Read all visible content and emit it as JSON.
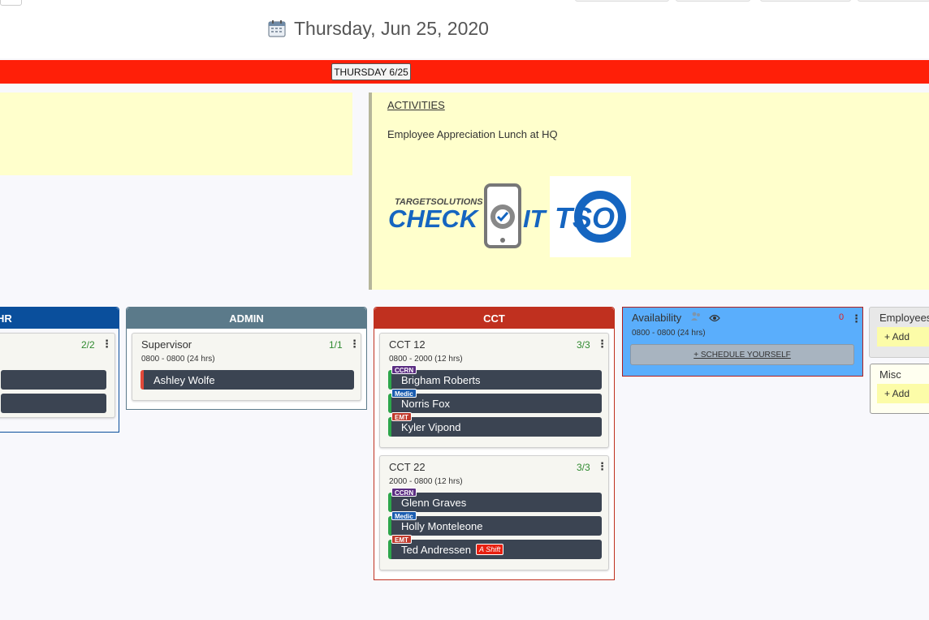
{
  "header": {
    "date": "Thursday, Jun 25, 2020"
  },
  "day_bar": {
    "day_button_label": "THURSDAY 6/25",
    "bar_color": "#ff1f08"
  },
  "notes": {
    "activities_title": "ACTIVITIES",
    "activities_item": "Employee Appreciation Lunch at HQ",
    "logos": {
      "checkit_top": "TARGETSOLUTIONS",
      "checkit_word_left": "CHECK",
      "checkit_word_right": "IT",
      "tso": "TSO"
    }
  },
  "columns": {
    "hr": {
      "title": "HR",
      "color": "#0a4f9c",
      "card": {
        "count": "2/2"
      }
    },
    "admin": {
      "title": "ADMIN",
      "color": "#5b7a8a",
      "card": {
        "title": "Supervisor",
        "count": "1/1",
        "time": "0800 - 0800 (24 hrs)",
        "people": [
          {
            "name": "Ashley Wolfe"
          }
        ]
      }
    },
    "cct": {
      "title": "CCT",
      "color": "#c0301f",
      "cards": [
        {
          "title": "CCT 12",
          "count": "3/3",
          "time": "0800 - 2000 (12 hrs)",
          "people": [
            {
              "badge": "CCRN",
              "name": "Brigham Roberts"
            },
            {
              "badge": "Medic",
              "name": "Norris Fox"
            },
            {
              "badge": "EMT",
              "name": "Kyler Vipond"
            }
          ]
        },
        {
          "title": "CCT 22",
          "count": "3/3",
          "time": "2000 - 0800 (12 hrs)",
          "people": [
            {
              "badge": "CCRN",
              "name": "Glenn Graves"
            },
            {
              "badge": "Medic",
              "name": "Holly Monteleone"
            },
            {
              "badge": "EMT",
              "name": "Ted Andressen",
              "tag": "A Shift"
            }
          ]
        }
      ]
    }
  },
  "availability": {
    "title": "Availability",
    "count": "0",
    "time": "0800 - 0800 (24 hrs)",
    "schedule_label": "+ SCHEDULE YOURSELF"
  },
  "side_panels": {
    "employees": {
      "title": "Employees",
      "add_label": "+ Add"
    },
    "misc": {
      "title": "Misc",
      "add_label": "+ Add"
    }
  },
  "icons": {
    "calendar": "calendar-icon",
    "kebab": "kebab-menu-icon",
    "visibility": "eye-icon",
    "shift-indicator": "people-icon"
  }
}
